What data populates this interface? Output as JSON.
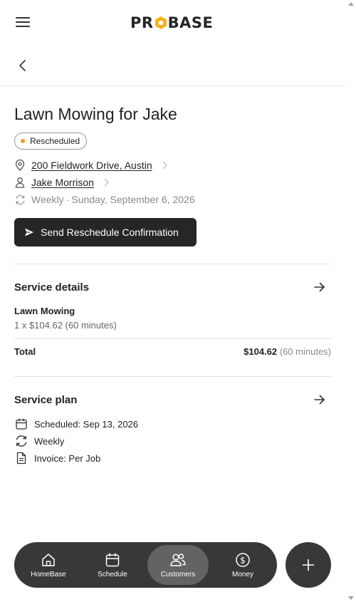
{
  "app": {
    "logo_left": "PR",
    "logo_right": "BASE",
    "brand_accent": "#f5b21b"
  },
  "header": {
    "title": "Lawn Mowing for Jake",
    "status": "Rescheduled",
    "status_color": "#f0a020"
  },
  "info": {
    "address": "200 Fieldwork Drive, Austin",
    "customer": "Jake Morrison",
    "recurrence": "Weekly",
    "separator": "·",
    "date": "Sunday, September 6, 2026"
  },
  "actions": {
    "send_label": "Send Reschedule Confirmation"
  },
  "service_details": {
    "title": "Service details",
    "item_name": "Lawn Mowing",
    "item_qty": "1 x $104.62 (60 minutes)",
    "total_label": "Total",
    "total_amount": "$104.62",
    "total_duration": "(60 minutes)"
  },
  "service_plan": {
    "title": "Service plan",
    "scheduled": "Scheduled: Sep 13, 2026",
    "frequency": "Weekly",
    "invoice": "Invoice: Per Job"
  },
  "nav": {
    "items": [
      {
        "label": "HomeBase",
        "icon": "home-icon"
      },
      {
        "label": "Schedule",
        "icon": "calendar-icon"
      },
      {
        "label": "Customers",
        "icon": "users-icon",
        "active": true
      },
      {
        "label": "Money",
        "icon": "dollar-icon"
      }
    ],
    "fab_icon": "plus-icon"
  }
}
